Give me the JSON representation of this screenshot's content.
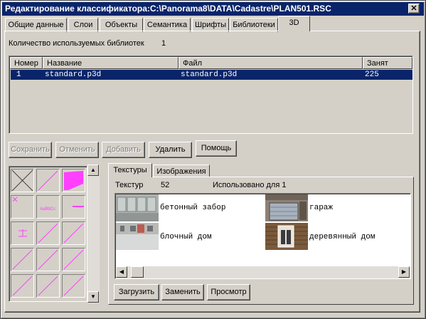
{
  "window": {
    "title": "Редактирование классификатора:C:\\Panorama8\\DATA\\Cadastre\\PLAN501.RSC",
    "close_glyph": "✕"
  },
  "tabs": [
    {
      "label": "Общие данные",
      "active": false
    },
    {
      "label": "Слои",
      "active": false
    },
    {
      "label": "Объекты",
      "active": false
    },
    {
      "label": "Семантика",
      "active": false
    },
    {
      "label": "Шрифты",
      "active": false
    },
    {
      "label": "Библиотеки",
      "active": false
    },
    {
      "label": "3D",
      "active": true
    }
  ],
  "libraries": {
    "count_label": "Количество используемых библиотек",
    "count": "1",
    "columns": [
      "Номер",
      "Название",
      "Файл",
      "Занят"
    ],
    "rows": [
      {
        "number": "1",
        "name": "standard.p3d",
        "file": "standard.p3d",
        "occupied": "225",
        "selected": true
      }
    ]
  },
  "actions": {
    "save": "Сохранить",
    "cancel": "Отменить",
    "add": "Добавить",
    "delete": "Удалить",
    "help": "Помощь"
  },
  "symbol_palette": {
    "accent_color": "#ff40ff",
    "icons": [
      "cross-box-icon",
      "diagonal-line-icon",
      "filled-polygon-icon",
      "mark-icon",
      "text-style-icon",
      "hline-icon",
      "symbol-icon",
      "diagonal-line-icon",
      "diagonal-line-icon",
      "diagonal-line-icon",
      "diagonal-line-icon",
      "diagonal-line-icon",
      "diagonal-line-icon",
      "diagonal-line-icon",
      "diagonal-line-icon"
    ],
    "text_sample": "AaBbCc"
  },
  "texture_tabs": [
    {
      "label": "Текстуры",
      "active": true
    },
    {
      "label": "Изображения",
      "active": false
    }
  ],
  "textures": {
    "label": "Текстур",
    "count": "52",
    "usage_label": "Использовано для 1",
    "items": [
      {
        "name": "бетонный забор",
        "icon": "concrete-fence-texture"
      },
      {
        "name": "гараж",
        "icon": "garage-texture"
      },
      {
        "name": "блочный дом",
        "icon": "block-house-texture"
      },
      {
        "name": "деревянный дом",
        "icon": "wooden-house-texture"
      }
    ]
  },
  "texture_actions": {
    "load": "Загрузить",
    "replace": "Заменить",
    "view": "Просмотр"
  },
  "colors": {
    "titlebar": "#0a246a",
    "face": "#d4d0c8",
    "selection": "#0a246a"
  }
}
